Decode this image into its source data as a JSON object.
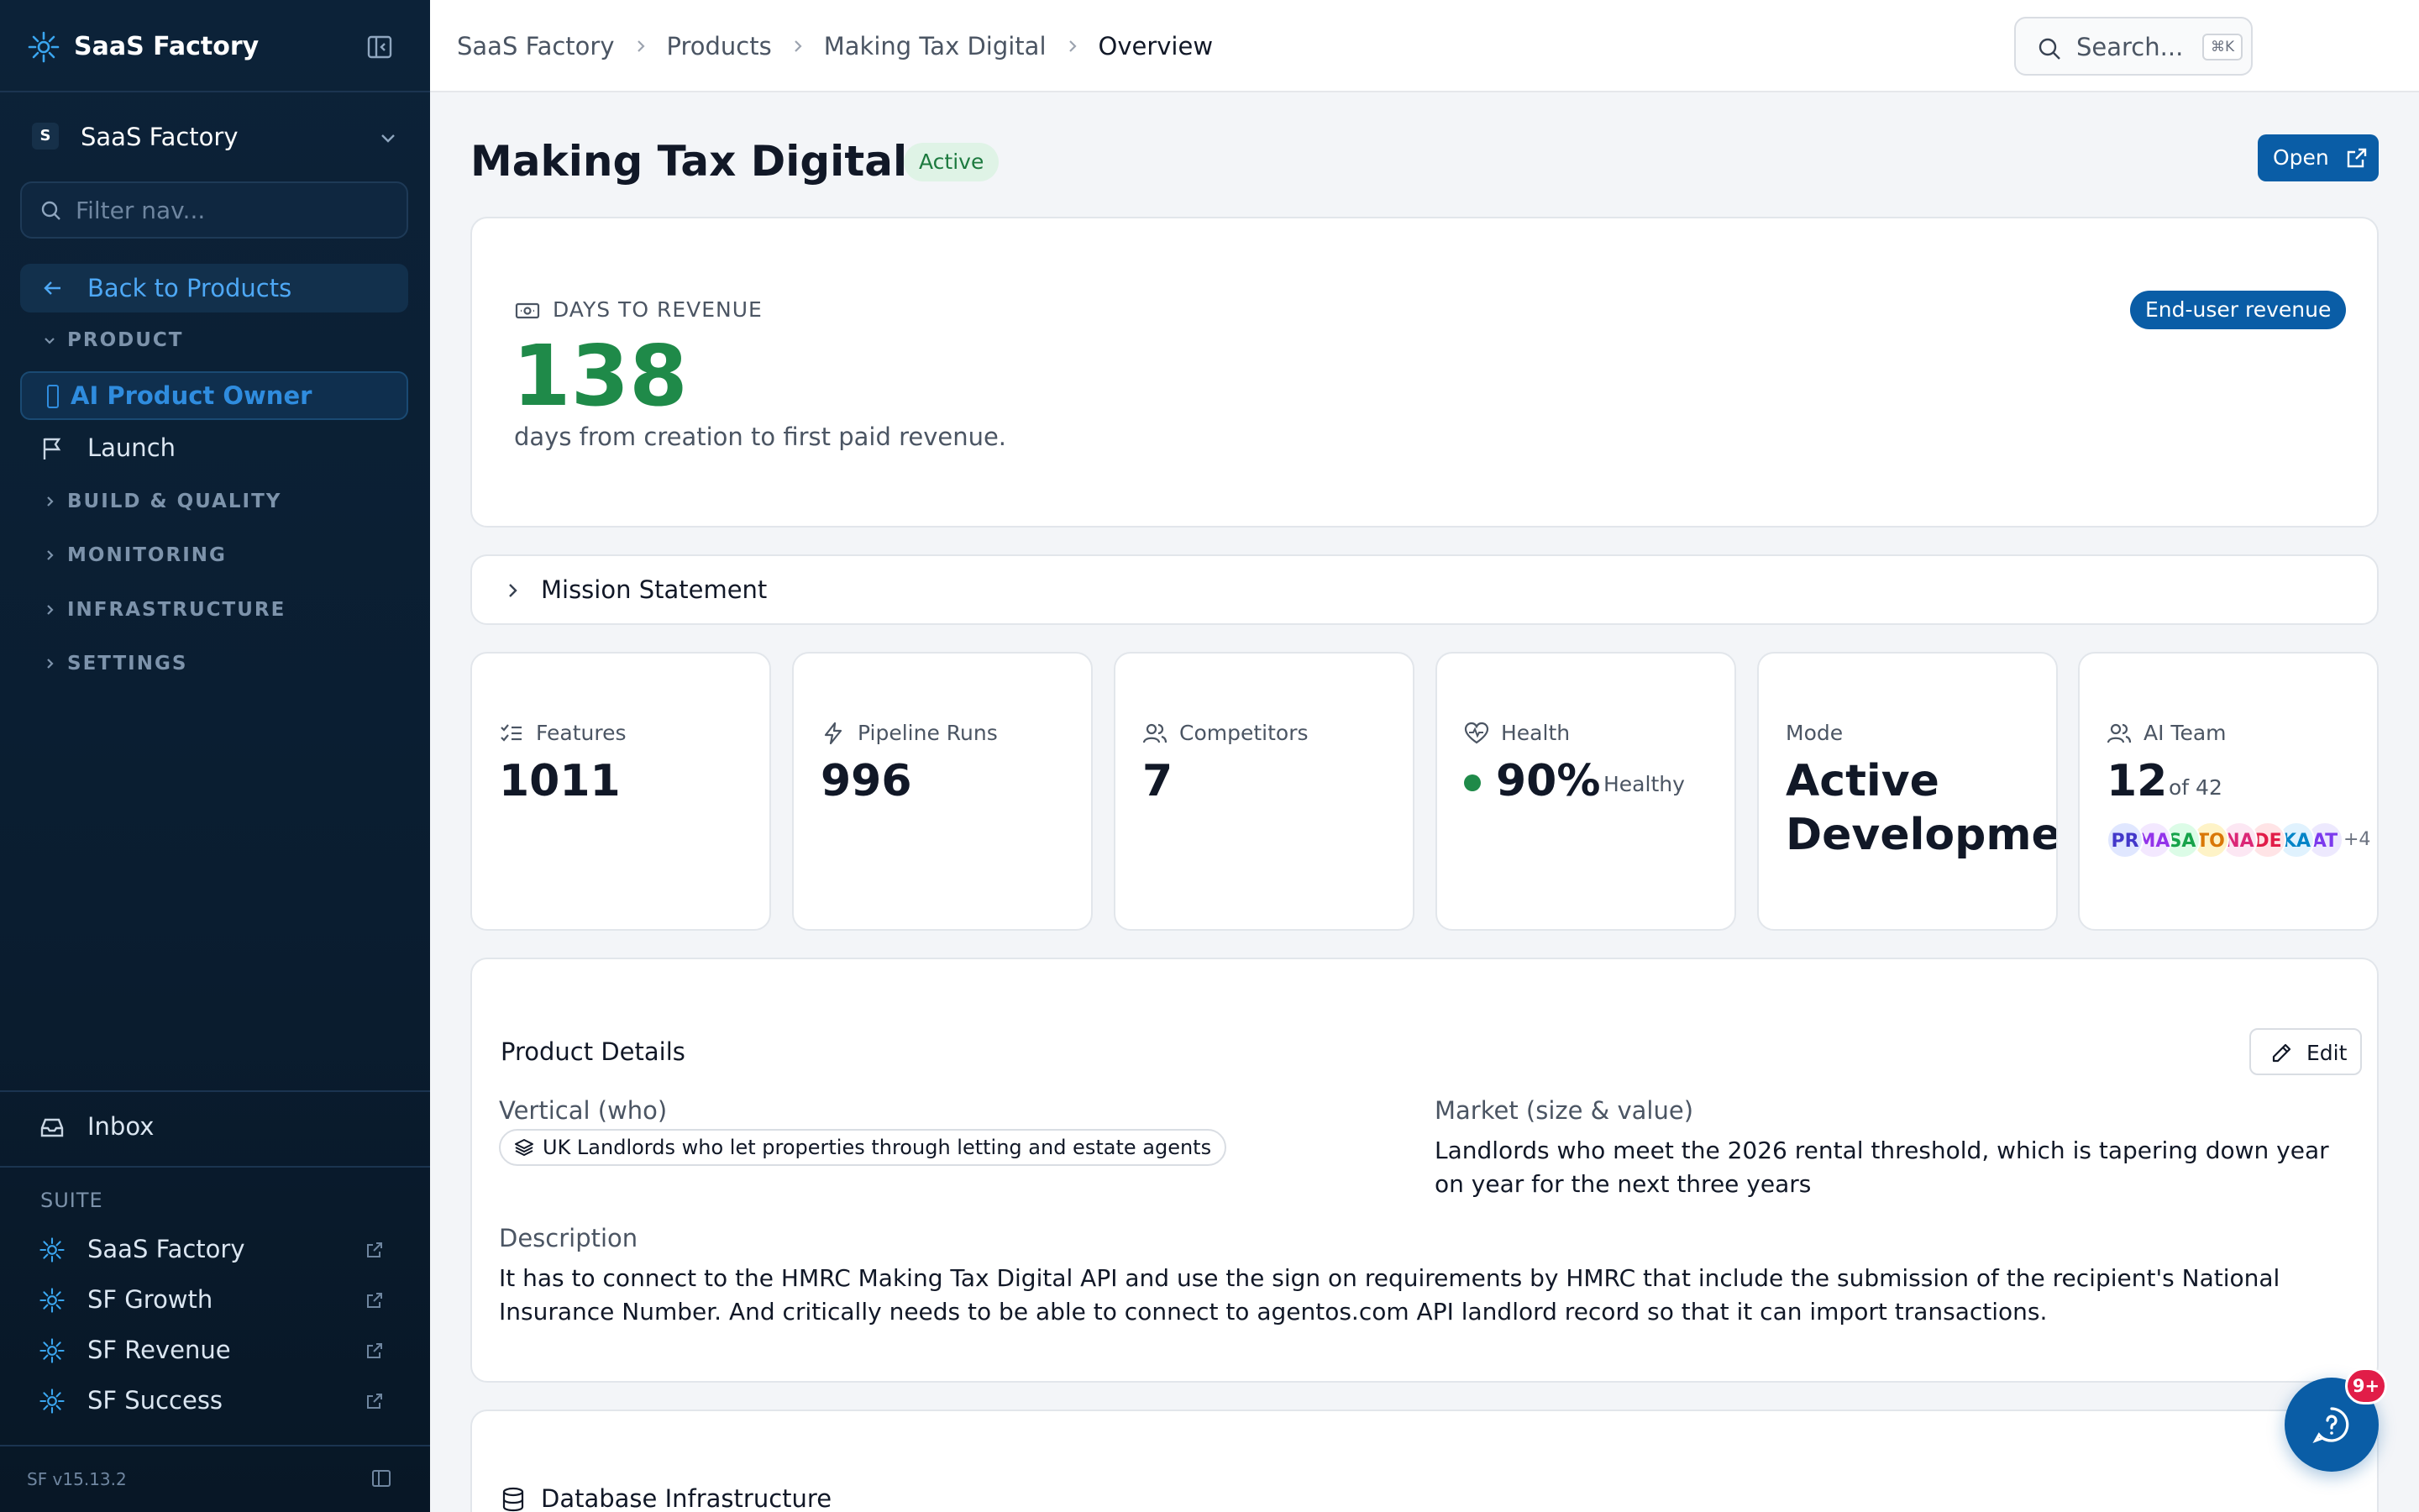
{
  "sidebar": {
    "app_title": "SaaS Factory",
    "workspace": {
      "initial": "S",
      "name": "SaaS Factory"
    },
    "filter_placeholder": "Filter nav...",
    "back_label": "Back to Products",
    "sections": {
      "product": "PRODUCT",
      "build_quality": "BUILD & QUALITY",
      "monitoring": "MONITORING",
      "infrastructure": "INFRASTRUCTURE",
      "settings": "SETTINGS"
    },
    "product_items": {
      "ai_product_owner": "AI Product Owner",
      "launch": "Launch"
    },
    "inbox_label": "Inbox",
    "suite_heading": "SUITE",
    "suite_items": [
      "SaaS Factory",
      "SF Growth",
      "SF Revenue",
      "SF Success"
    ],
    "version": "SF v15.13.2"
  },
  "topbar": {
    "breadcrumbs": [
      "SaaS Factory",
      "Products",
      "Making Tax Digital",
      "Overview"
    ],
    "search_label": "Search...",
    "search_shortcut": "⌘K"
  },
  "page": {
    "title": "Making Tax Digital",
    "status": "Active",
    "open_label": "Open"
  },
  "revenue": {
    "label": "DAYS TO REVENUE",
    "value": "138",
    "subtitle": "days from creation to first paid revenue.",
    "tag": "End-user revenue"
  },
  "mission": {
    "label": "Mission Statement"
  },
  "stats": {
    "features": {
      "label": "Features",
      "value": "1011"
    },
    "pipeline_runs": {
      "label": "Pipeline Runs",
      "value": "996"
    },
    "competitors": {
      "label": "Competitors",
      "value": "7"
    },
    "health": {
      "label": "Health",
      "value": "90%",
      "status": "Healthy"
    },
    "mode": {
      "label": "Mode",
      "value": "Active Development"
    },
    "ai_team": {
      "label": "AI Team",
      "value": "12",
      "of_text": "of 42",
      "avatars": [
        {
          "initials": "PR",
          "bg": "#e0e7ff",
          "fg": "#4338ca"
        },
        {
          "initials": "MA",
          "bg": "#f3e8ff",
          "fg": "#9333ea"
        },
        {
          "initials": "SA",
          "bg": "#dcfce7",
          "fg": "#16a34a"
        },
        {
          "initials": "TO",
          "bg": "#fef3c7",
          "fg": "#d97706"
        },
        {
          "initials": "NA",
          "bg": "#fce7f3",
          "fg": "#db2777"
        },
        {
          "initials": "DE",
          "bg": "#ffe4e6",
          "fg": "#e11d48"
        },
        {
          "initials": "KA",
          "bg": "#e0f2fe",
          "fg": "#0284c7"
        },
        {
          "initials": "AT",
          "bg": "#ede9fe",
          "fg": "#7c3aed"
        }
      ],
      "more": "+4"
    }
  },
  "details": {
    "title": "Product Details",
    "edit_label": "Edit",
    "vertical_label": "Vertical (who)",
    "vertical_value": "UK Landlords who let properties through letting and estate agents",
    "market_label": "Market (size & value)",
    "market_value": "Landlords who meet the 2026 rental threshold, which is tapering down year on year for the next three years",
    "description_label": "Description",
    "description_value": "It has to connect to the HMRC Making Tax Digital API and use the sign on requirements by HMRC that include the submission of the recipient's National Insurance Number. And critically needs to be able to connect to agentos.com API landlord record so that it can import transactions."
  },
  "database": {
    "label": "Database Infrastructure"
  },
  "help": {
    "badge": "9+"
  },
  "colors": {
    "accent": "#0a5da6",
    "success": "#1f8a49",
    "sidebar_bg": "#0c2238",
    "sidebar_active": "#2f8cde"
  }
}
